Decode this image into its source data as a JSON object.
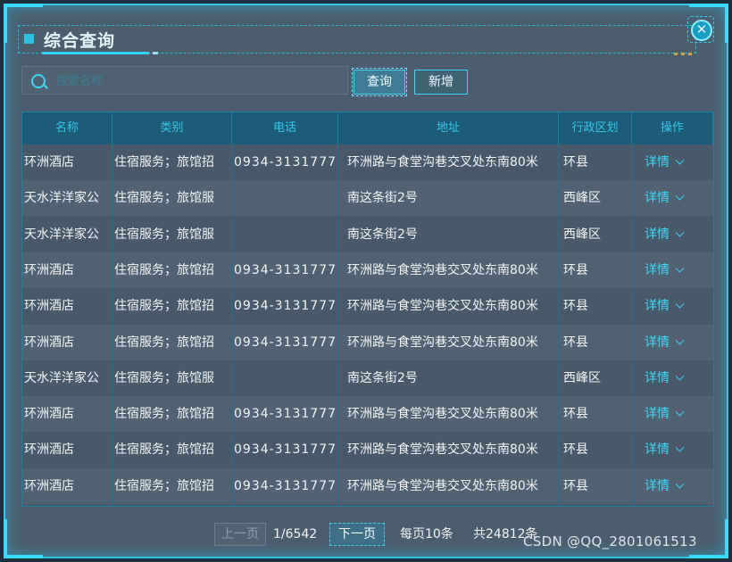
{
  "dialog": {
    "title": "综合查询",
    "close_symbol": "✕"
  },
  "search": {
    "placeholder": "搜索名称",
    "value": ""
  },
  "buttons": {
    "query": "查询",
    "add": "新增"
  },
  "table": {
    "headers": [
      "名称",
      "类别",
      "电话",
      "地址",
      "行政区划",
      "操作"
    ],
    "rows": [
      [
        "环洲酒店",
        "住宿服务；旅馆招",
        "0934-3131777",
        "环洲路与食堂沟巷交叉处东南80米",
        "环县",
        "详情"
      ],
      [
        "天水洋洋家公",
        "住宿服务；旅馆服",
        "",
        "南这条街2号",
        "西峰区",
        "详情"
      ],
      [
        "天水洋洋家公",
        "住宿服务；旅馆服",
        "",
        "南这条街2号",
        "西峰区",
        "详情"
      ],
      [
        "环洲酒店",
        "住宿服务；旅馆招",
        "0934-3131777",
        "环洲路与食堂沟巷交叉处东南80米",
        "环县",
        "详情"
      ],
      [
        "环洲酒店",
        "住宿服务；旅馆招",
        "0934-3131777",
        "环洲路与食堂沟巷交叉处东南80米",
        "环县",
        "详情"
      ],
      [
        "环洲酒店",
        "住宿服务；旅馆招",
        "0934-3131777",
        "环洲路与食堂沟巷交叉处东南80米",
        "环县",
        "详情"
      ],
      [
        "天水洋洋家公",
        "住宿服务；旅馆服",
        "",
        "南这条街2号",
        "西峰区",
        "详情"
      ],
      [
        "环洲酒店",
        "住宿服务；旅馆招",
        "0934-3131777",
        "环洲路与食堂沟巷交叉处东南80米",
        "环县",
        "详情"
      ],
      [
        "环洲酒店",
        "住宿服务；旅馆招",
        "0934-3131777",
        "环洲路与食堂沟巷交叉处东南80米",
        "环县",
        "详情"
      ],
      [
        "环洲酒店",
        "住宿服务；旅馆招",
        "0934-3131777",
        "环洲路与食堂沟巷交叉处东南80米",
        "环县",
        "详情"
      ]
    ]
  },
  "pagination": {
    "prev": "上一页",
    "page_info": "1/6542",
    "next": "下一页",
    "per_page": "每页10条",
    "total": "共24812条"
  },
  "watermark": "CSDN @QQ_2801061513",
  "colors": {
    "accent": "#2fc6e6",
    "panel": "#4c5e6e",
    "header": "#1d5c78"
  }
}
